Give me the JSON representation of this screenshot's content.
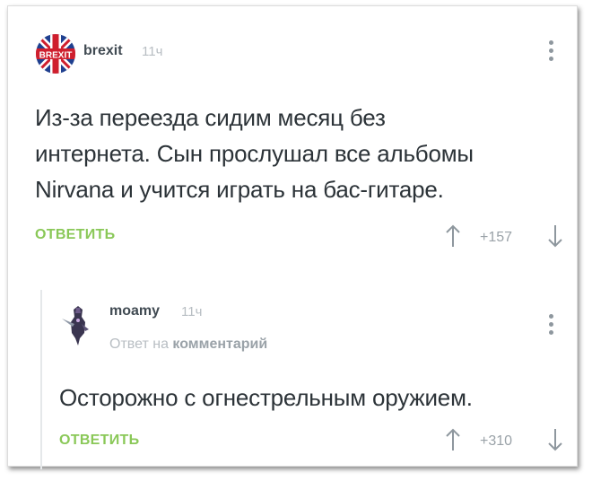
{
  "comment1": {
    "avatar_icon": "brexit-flag-icon",
    "avatar_text": "BREXIT",
    "username": "brexit",
    "time": "11ч",
    "text_lines": [
      "Из-за переезда сидим месяц без",
      "интернета. Сын прослушал все альбомы",
      "Nirvana и учится играть на бас-гитаре."
    ],
    "reply_label": "ОТВЕТИТЬ",
    "rating": "+157",
    "upvote_icon": "arrow-up-icon",
    "downvote_icon": "arrow-down-icon",
    "menu_icon": "kebab-menu-icon"
  },
  "comment2": {
    "avatar_icon": "character-avatar-icon",
    "username": "moamy",
    "time": "11ч",
    "reply_to_prefix": "Ответ на",
    "reply_to_link": "комментарий",
    "text": "Осторожно с огнестрельным оружием.",
    "reply_label": "ОТВЕТИТЬ",
    "rating": "+310",
    "upvote_icon": "arrow-up-icon",
    "downvote_icon": "arrow-down-icon",
    "menu_icon": "kebab-menu-icon"
  },
  "colors": {
    "reply_green": "#8ac858",
    "text": "#2c3338",
    "muted": "#b8bec3",
    "flag_blue": "#1f3f8f",
    "flag_red": "#cf1f2e"
  }
}
